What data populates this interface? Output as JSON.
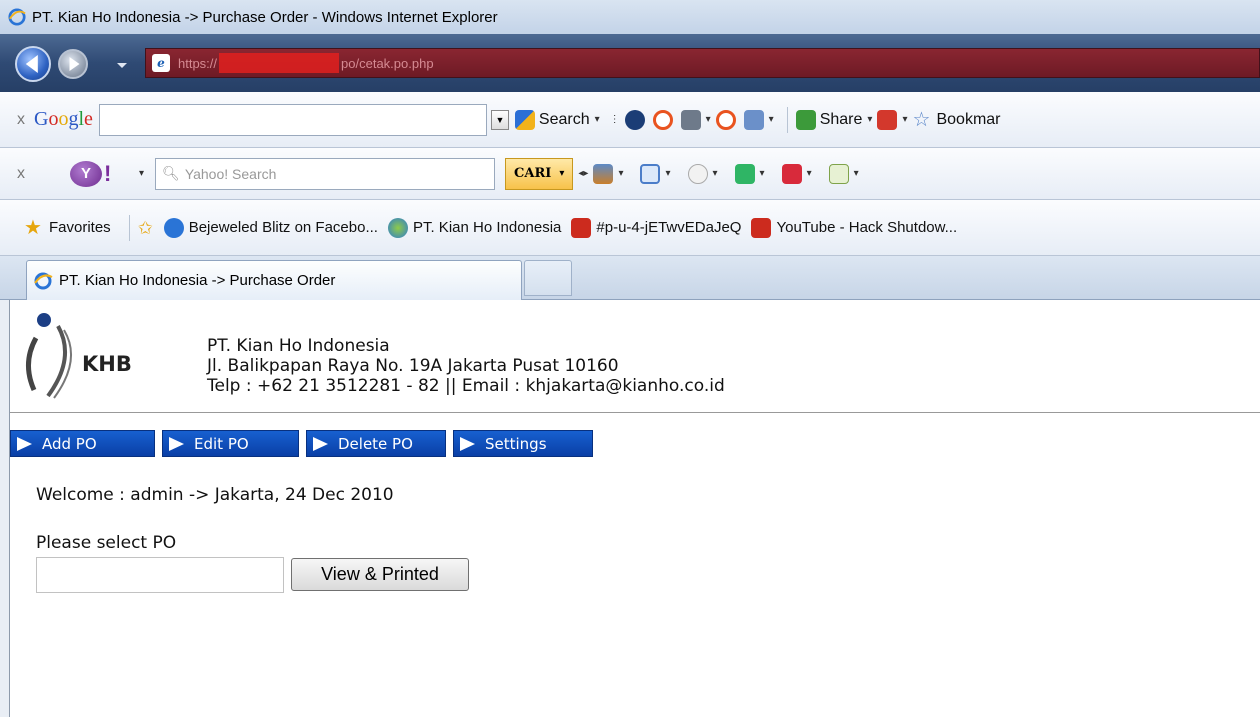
{
  "window": {
    "title": "PT. Kian Ho Indonesia -> Purchase Order - Windows Internet Explorer"
  },
  "address_bar": {
    "url_prefix": "https://",
    "url_suffix": "po/cetak.po.php"
  },
  "google_toolbar": {
    "close": "x",
    "logo_letters": [
      "G",
      "o",
      "o",
      "g",
      "l",
      "e"
    ],
    "search_label": "Search",
    "share_label": "Share",
    "bookmarks_label": "Bookmar"
  },
  "yahoo_toolbar": {
    "close": "x",
    "logo_mark": "Y",
    "logo_bang": "!",
    "search_placeholder": "Yahoo! Search",
    "cari_label": "CARI"
  },
  "favorites_bar": {
    "favorites_label": "Favorites",
    "items": [
      "Bejeweled Blitz on Facebo...",
      "PT. Kian Ho Indonesia",
      "#p-u-4-jETwvEDaJeQ",
      "YouTube - Hack Shutdow..."
    ]
  },
  "tabs": {
    "active_label": "PT. Kian Ho Indonesia -> Purchase Order"
  },
  "page": {
    "logo_text": "KHB",
    "company_name": "PT. Kian Ho Indonesia",
    "company_address": "Jl. Balikpapan Raya No. 19A Jakarta Pusat 10160",
    "company_contact": "Telp : +62 21 3512281 - 82 || Email : khjakarta@kianho.co.id",
    "menu": [
      "Add PO",
      "Edit PO",
      "Delete PO",
      "Settings"
    ],
    "welcome": "Welcome : admin -> Jakarta, 24 Dec 2010",
    "select_label": "Please select PO",
    "po_input_value": "",
    "view_button": "View & Printed"
  },
  "colors": {
    "menu_blue": "#0f4fbf",
    "address_bar_red": "#7a1e2a",
    "chrome_light": "#e7edf6"
  }
}
